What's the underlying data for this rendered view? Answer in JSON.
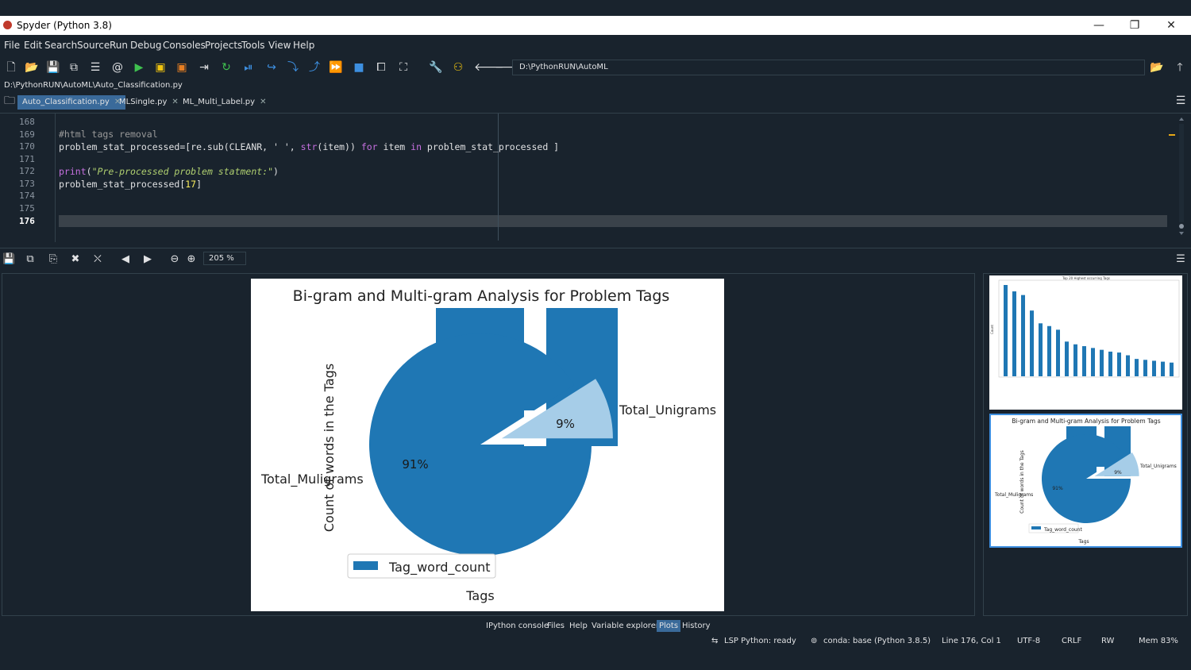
{
  "window": {
    "title": "Spyder (Python 3.8)",
    "min": "—",
    "max": "❐",
    "close": "✕"
  },
  "menu": [
    "File",
    "Edit",
    "Search",
    "Source",
    "Run",
    "Debug",
    "Consoles",
    "Projects",
    "Tools",
    "View",
    "Help"
  ],
  "toolbar": {
    "path": "D:\\PythonRUN\\AutoML"
  },
  "file_path": "D:\\PythonRUN\\AutoML\\Auto_Classification.py",
  "tabs": [
    {
      "label": "Auto_Classification.py",
      "active": true
    },
    {
      "label": "MLSingle.py",
      "active": false
    },
    {
      "label": "ML_Multi_Label.py",
      "active": false
    }
  ],
  "editor": {
    "line_numbers": [
      "168",
      "169",
      "170",
      "171",
      "172",
      "173",
      "174",
      "175",
      "176"
    ],
    "current_line": "176",
    "code": {
      "comment": "#html tags removal",
      "l170_a": "problem_stat_processed=[re.sub(CLEANR, ' ', ",
      "l170_str": "str",
      "l170_b": "(item)) ",
      "l170_for": "for",
      "l170_c": " item ",
      "l170_in": "in",
      "l170_d": " problem_stat_processed ]",
      "l172_print": "print",
      "l172_a": "(",
      "l172_str": "\"Pre-processed problem statment:\"",
      "l172_b": ")",
      "l173_a": "problem_stat_processed[",
      "l173_num": "17",
      "l173_b": "]"
    }
  },
  "plots": {
    "zoom": "205 %",
    "main_plot": {
      "title": "Bi-gram and Multi-gram Analysis for Problem Tags",
      "ylabel": "Count of words in the Tags",
      "xlabel": "Tags",
      "legend": "Tag_word_count",
      "slices": [
        {
          "label": "Total_Muligrams",
          "pct": "91%",
          "value": 91,
          "color": "#1f77b4"
        },
        {
          "label": "Total_Unigrams",
          "pct": "9%",
          "value": 9,
          "color": "#a6cde8"
        }
      ]
    },
    "thumb_bar": {
      "title": "Top 20 Highest occurring Tags",
      "ylabel": "Count",
      "values": [
        100,
        93,
        89,
        72,
        58,
        55,
        51,
        38,
        35,
        33,
        31,
        29,
        27,
        26,
        23,
        19,
        18,
        17,
        16,
        15
      ]
    },
    "thumb_pie": {
      "title": "Bi-gram and Multi-gram Analysis for Problem Tags",
      "ylabel": "Count of words in the Tags",
      "xlabel": "Tags",
      "legend": "Tag_word_count",
      "label_big": "Total_Muligrams",
      "label_small": "Total_Unigrams",
      "pct_big": "91%",
      "pct_small": "9%"
    }
  },
  "pane_tabs": [
    {
      "label": "IPython console",
      "active": false
    },
    {
      "label": "Files",
      "active": false
    },
    {
      "label": "Help",
      "active": false
    },
    {
      "label": "Variable explorer",
      "active": false
    },
    {
      "label": "Plots",
      "active": true
    },
    {
      "label": "History",
      "active": false
    }
  ],
  "status": {
    "lsp": "LSP Python: ready",
    "conda": "conda: base (Python 3.8.5)",
    "position": "Line 176, Col 1",
    "encoding": "UTF-8",
    "eol": "CRLF",
    "mode": "RW",
    "mem": "Mem 83%"
  },
  "colors": {
    "bg": "#19232d",
    "accent": "#3a6a9a",
    "pie_dark": "#1f77b4",
    "pie_light": "#a6cde8"
  }
}
